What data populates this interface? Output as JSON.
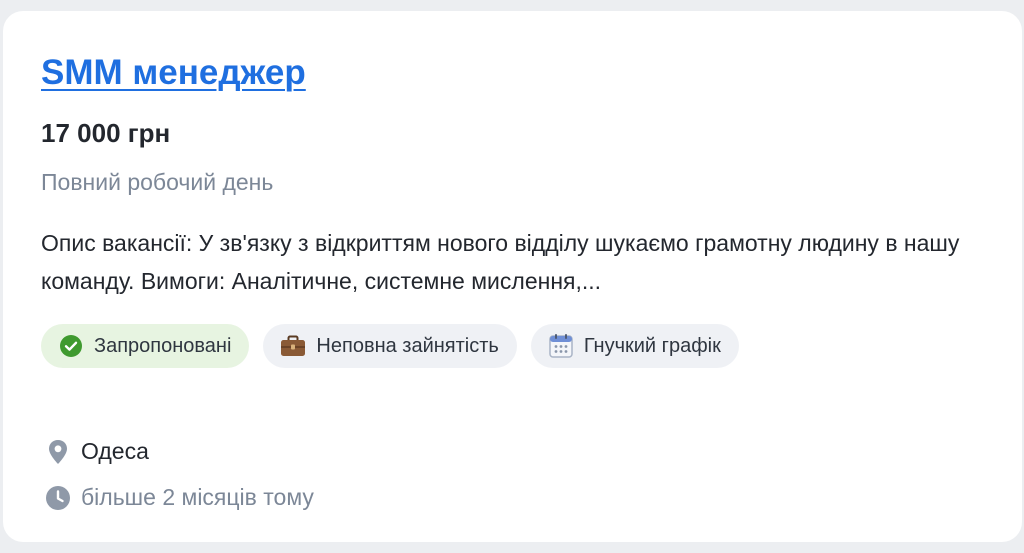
{
  "vacancy": {
    "title": "SMM менеджер",
    "salary": "17 000 грн",
    "employment": "Повний робочий день",
    "description": "Опис вакансії: У зв'язку з відкриттям нового відділу шукаємо грамотну людину в нашу команду. Вимоги: Аналітичне, системне мислення,...",
    "tags": [
      {
        "label": "Запропоновані",
        "icon": "check-circle-icon"
      },
      {
        "label": "Неповна зайнятість",
        "icon": "briefcase-icon"
      },
      {
        "label": "Гнучкий графік",
        "icon": "calendar-icon"
      }
    ],
    "city": "Одеса",
    "posted": "більше 2 місяців тому"
  },
  "colors": {
    "link": "#1f6fe0",
    "muted": "#7c8797",
    "check_green": "#3f9a2f",
    "tag_green_bg": "#e7f4e1",
    "tag_bg": "#eff1f5",
    "page_bg": "#eceef1"
  }
}
